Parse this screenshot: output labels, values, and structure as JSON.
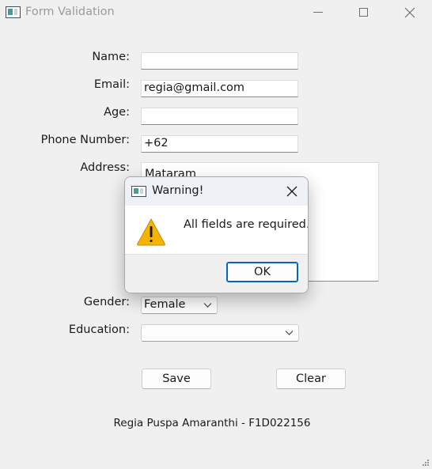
{
  "window": {
    "title": "Form Validation",
    "icon": "app-window-icon",
    "controls": [
      "minimize-icon",
      "maximize-icon",
      "close-icon"
    ]
  },
  "form": {
    "name": {
      "label": "Name:",
      "value": ""
    },
    "email": {
      "label": "Email:",
      "value": "regia@gmail.com"
    },
    "age": {
      "label": "Age:",
      "value": ""
    },
    "phone": {
      "label": "Phone Number:",
      "value": "+62"
    },
    "address": {
      "label": "Address:",
      "value": "Mataram"
    },
    "gender": {
      "label": "Gender:",
      "selected": "Female"
    },
    "education": {
      "label": "Education:",
      "selected": ""
    }
  },
  "buttons": {
    "save_label": "Save",
    "clear_label": "Clear"
  },
  "footer": {
    "text": "Regia Puspa Amaranthi - F1D022156"
  },
  "dialog": {
    "title": "Warning!",
    "message": "All fields are required.",
    "ok_label": "OK",
    "icon": "warning-icon",
    "accent_color": "#0067c0",
    "warning_color": "#f5b400"
  }
}
